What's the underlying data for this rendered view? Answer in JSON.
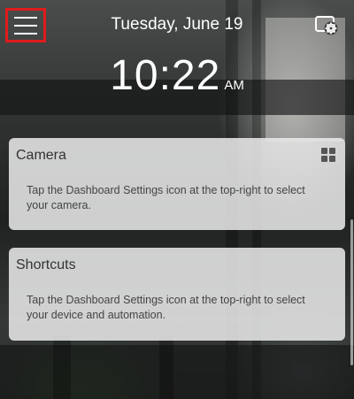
{
  "header": {
    "date": "Tuesday, June 19",
    "menu_icon": "hamburger-menu-icon",
    "settings_icon": "dashboard-settings-icon"
  },
  "clock": {
    "time": "10:22",
    "ampm": "AM"
  },
  "cards": {
    "camera": {
      "title": "Camera",
      "body": "Tap the Dashboard Settings icon at the top-right to select your camera.",
      "icon": "grid-icon"
    },
    "shortcuts": {
      "title": "Shortcuts",
      "body": "Tap the Dashboard Settings icon at the top-right to select your device and automation."
    }
  },
  "colors": {
    "highlight": "#e01b1b",
    "text_light": "#ffffff",
    "card_bg": "#ebebeb"
  }
}
